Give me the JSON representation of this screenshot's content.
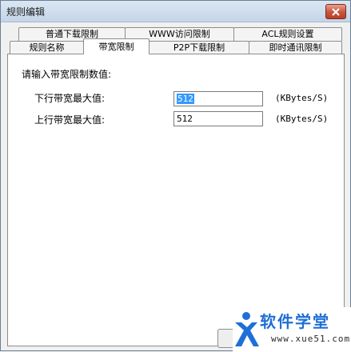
{
  "window": {
    "title": "规则编辑"
  },
  "tabs_back": [
    "普通下载限制",
    "WWW访问限制",
    "ACL规则设置"
  ],
  "tabs_front": [
    "规则名称",
    "带宽限制",
    "P2P下载限制",
    "即时通讯限制"
  ],
  "active_tab": "带宽限制",
  "bandwidth": {
    "heading": "请输入带宽限制数值:",
    "download_label": "下行带宽最大值:",
    "download_value": "512",
    "upload_label": "上行带宽最大值:",
    "upload_value": "512",
    "unit": "(KBytes/S)"
  },
  "watermark": {
    "name": "软件学堂",
    "url": "www.xue51.com"
  },
  "colors": {
    "accent": "#3399ff",
    "close": "#c9533a",
    "watermark": "#1f6fd6"
  }
}
